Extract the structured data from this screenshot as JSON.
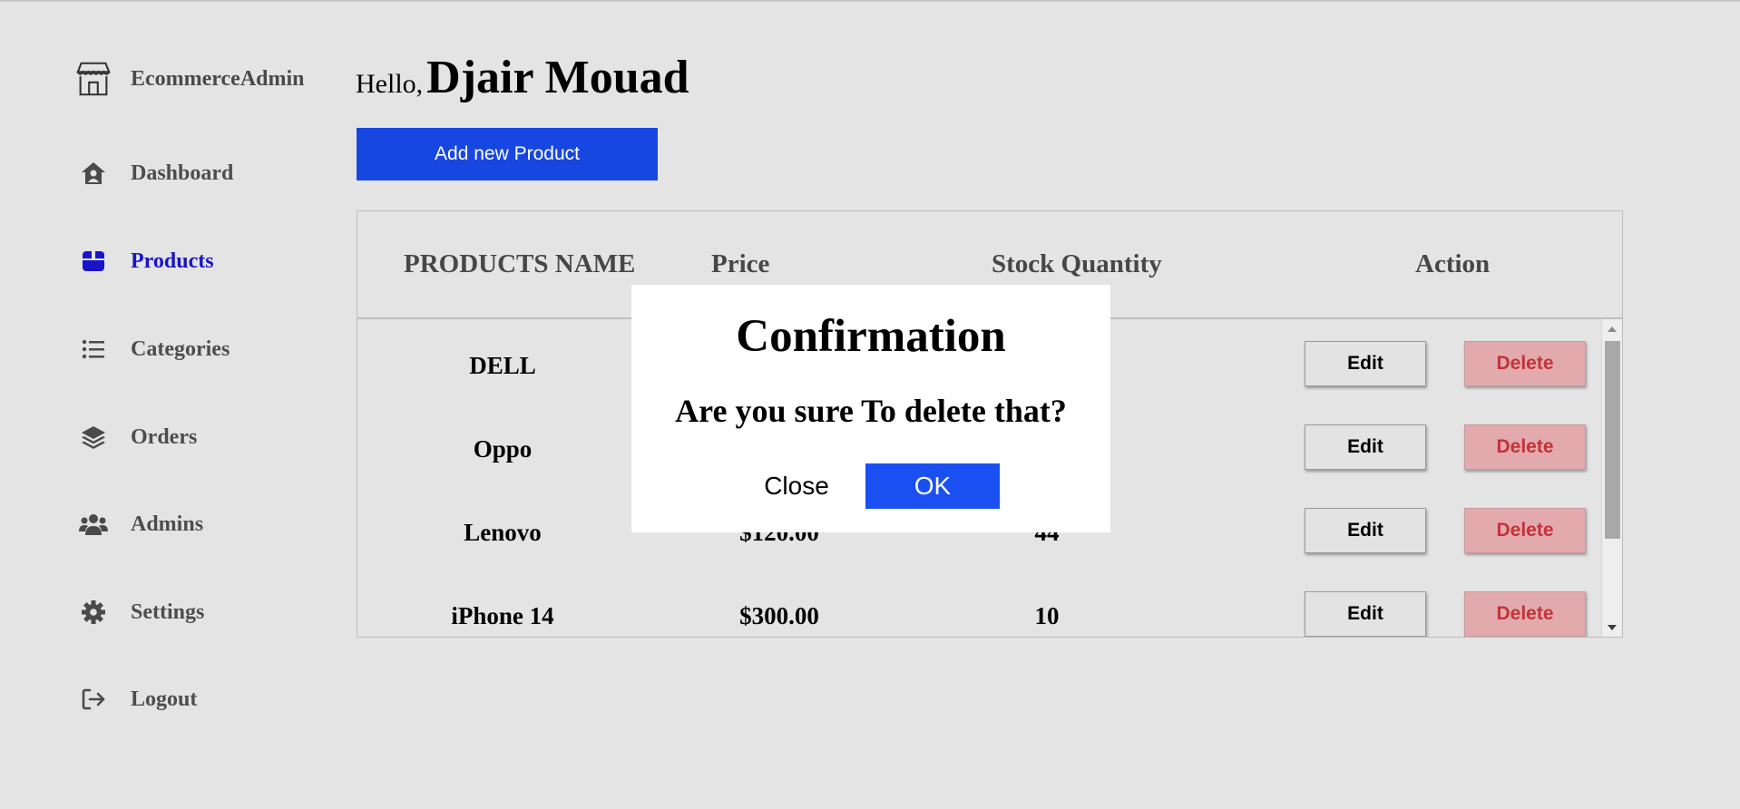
{
  "brand": {
    "name": "EcommerceAdmin",
    "icon": "store-icon"
  },
  "sidebar": {
    "items": [
      {
        "label": "Dashboard",
        "icon": "home-icon"
      },
      {
        "label": "Products",
        "icon": "box-icon",
        "active": true
      },
      {
        "label": "Categories",
        "icon": "list-icon"
      },
      {
        "label": "Orders",
        "icon": "layers-icon"
      },
      {
        "label": "Admins",
        "icon": "users-icon"
      },
      {
        "label": "Settings",
        "icon": "gear-icon"
      },
      {
        "label": "Logout",
        "icon": "logout-icon"
      }
    ]
  },
  "header": {
    "greeting": "Hello,",
    "user_name": "Djair Mouad"
  },
  "actions": {
    "add_product_label": "Add new Product"
  },
  "table": {
    "columns": [
      "PRODUCTS NAME",
      "Price",
      "Stock Quantity",
      "Action"
    ],
    "rows": [
      {
        "name": "DELL",
        "price": "",
        "stock": ""
      },
      {
        "name": "Oppo",
        "price": "",
        "stock": ""
      },
      {
        "name": "Lenovo",
        "price": "$120.00",
        "stock": "44"
      },
      {
        "name": "iPhone 14",
        "price": "$300.00",
        "stock": "10"
      }
    ],
    "edit_label": "Edit",
    "delete_label": "Delete"
  },
  "modal": {
    "title": "Confirmation",
    "message": "Are you sure To delete that?",
    "close_label": "Close",
    "ok_label": "OK"
  },
  "colors": {
    "background": "#e4e4e4",
    "accent": "#1746e0",
    "active_nav": "#1a14c7",
    "delete_bg": "#e3aaad",
    "delete_text": "#c4323a"
  }
}
